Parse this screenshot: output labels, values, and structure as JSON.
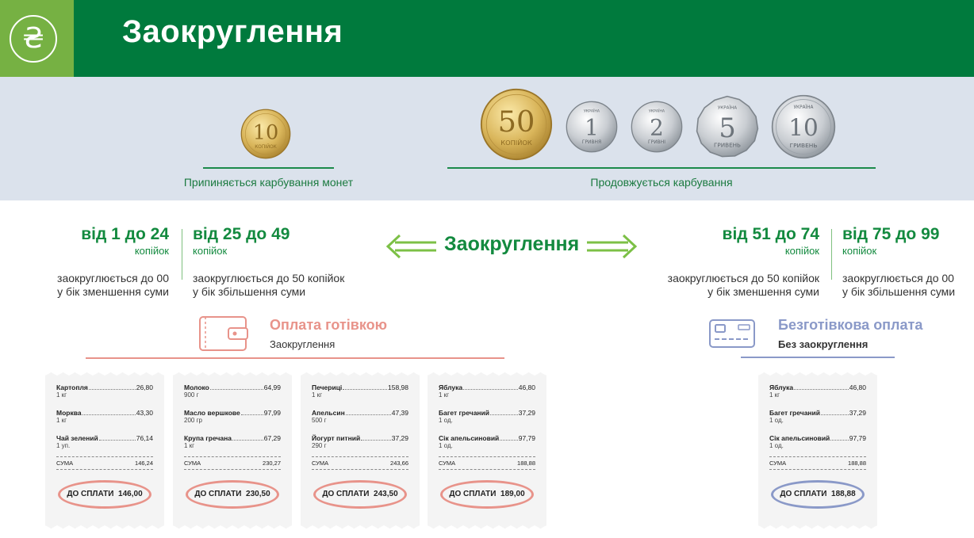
{
  "header": {
    "title": "Заокруглення",
    "logo_icon": "hryvnia-icon",
    "logo_glyph": "₴"
  },
  "coins": {
    "stopped": {
      "caption": "Припиняється карбування монет",
      "coins": [
        {
          "value": "10",
          "label": "КОПІЙОК"
        }
      ]
    },
    "continued": {
      "caption": "Продовжується карбування",
      "coins": [
        {
          "value": "50",
          "label": "КОПІЙОК"
        },
        {
          "value": "1",
          "label": "ГРИВНЯ",
          "top": "УКРАЇНА"
        },
        {
          "value": "2",
          "label": "ГРИВНІ",
          "top": "УКРАЇНА"
        },
        {
          "value": "5",
          "label": "ГРИВЕНЬ",
          "top": "УКРАЇНА"
        },
        {
          "value": "10",
          "label": "ГРИВЕНЬ",
          "top": "УКРАЇНА"
        }
      ]
    }
  },
  "rounding": {
    "center_label": "Заокруглення",
    "ranges": [
      {
        "range": "від 1 до 24",
        "unit": "копійок",
        "desc1": "заокруглюється до 00",
        "desc2": "у бік зменшення суми"
      },
      {
        "range": "від 25 до 49",
        "unit": "копійок",
        "desc1": "заокруглюється до 50 копійок",
        "desc2": "у бік збільшення суми"
      },
      {
        "range": "від 51 до 74",
        "unit": "копійок",
        "desc1": "заокруглюється до 50 копійок",
        "desc2": "у бік зменшення суми"
      },
      {
        "range": "від 75 до 99",
        "unit": "копійок",
        "desc1": "заокруглюється до 00",
        "desc2": "у бік збільшення суми"
      }
    ]
  },
  "payments": {
    "cash": {
      "title": "Оплата готівкою",
      "subtitle": "Заокруглення",
      "icon": "wallet-icon",
      "color": "#e8938a"
    },
    "cashless": {
      "title": "Безготівкова оплата",
      "subtitle": "Без заокруглення",
      "icon": "card-icon",
      "color": "#8a99c8"
    }
  },
  "receipts": [
    {
      "items": [
        {
          "name": "Картопля",
          "price": "26,80",
          "qty": "1 кг"
        },
        {
          "name": "Морква",
          "price": "43,30",
          "qty": "1 кг"
        },
        {
          "name": "Чай зелений",
          "price": "76,14",
          "qty": "1 уп."
        }
      ],
      "sum_label": "СУМА",
      "sum": "146,24",
      "pay_label": "ДО СПЛАТИ",
      "pay": "146,00"
    },
    {
      "items": [
        {
          "name": "Молоко",
          "price": "64,99",
          "qty": "900 г"
        },
        {
          "name": "Масло вершкове",
          "price": "97,99",
          "qty": "200 гр"
        },
        {
          "name": "Крупа гречана",
          "price": "67,29",
          "qty": "1 кг"
        }
      ],
      "sum_label": "СУМА",
      "sum": "230,27",
      "pay_label": "ДО СПЛАТИ",
      "pay": "230,50"
    },
    {
      "items": [
        {
          "name": "Печериці",
          "price": "158,98",
          "qty": "1 кг"
        },
        {
          "name": "Апельсин",
          "price": "47,39",
          "qty": "500 г"
        },
        {
          "name": "Йогурт питний",
          "price": "37,29",
          "qty": "290 г"
        }
      ],
      "sum_label": "СУМА",
      "sum": "243,66",
      "pay_label": "ДО СПЛАТИ",
      "pay": "243,50"
    },
    {
      "items": [
        {
          "name": "Яблука",
          "price": "46,80",
          "qty": "1 кг"
        },
        {
          "name": "Багет гречаний",
          "price": "37,29",
          "qty": "1 од."
        },
        {
          "name": "Сік апельсиновий",
          "price": "97,79",
          "qty": "1 од."
        }
      ],
      "sum_label": "СУМА",
      "sum": "188,88",
      "pay_label": "ДО СПЛАТИ",
      "pay": "189,00"
    },
    {
      "items": [
        {
          "name": "Яблука",
          "price": "46,80",
          "qty": "1 кг"
        },
        {
          "name": "Багет гречаний",
          "price": "37,29",
          "qty": "1 од."
        },
        {
          "name": "Сік апельсиновий",
          "price": "97,79",
          "qty": "1 од."
        }
      ],
      "sum_label": "СУМА",
      "sum": "188,88",
      "pay_label": "ДО СПЛАТИ",
      "pay": "188,88"
    }
  ]
}
